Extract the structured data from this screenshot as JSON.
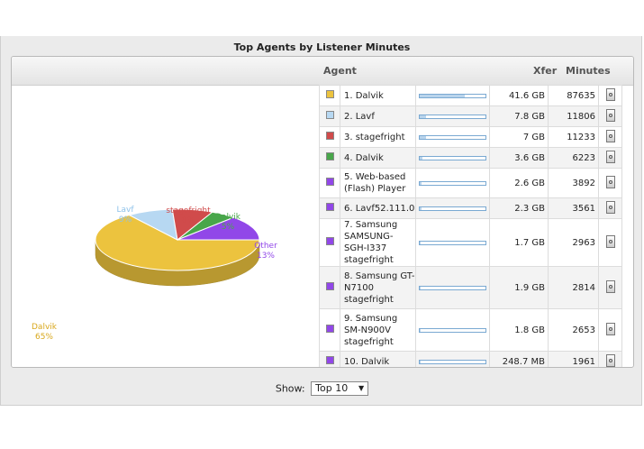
{
  "title": "Top Agents by Listener Minutes",
  "columns": {
    "agent": "Agent",
    "xfer": "Xfer",
    "minutes": "Minutes"
  },
  "rows": [
    {
      "name": "1. Dalvik",
      "xfer": "41.6 GB",
      "minutes": "87635",
      "color": "#ecc33e",
      "bar": 0.68
    },
    {
      "name": "2. Lavf",
      "xfer": "7.8 GB",
      "minutes": "11806",
      "color": "#b7d8f2",
      "bar": 0.1
    },
    {
      "name": "3. stagefright",
      "xfer": "7 GB",
      "minutes": "11233",
      "color": "#d04b4b",
      "bar": 0.09
    },
    {
      "name": "4. Dalvik",
      "xfer": "3.6 GB",
      "minutes": "6223",
      "color": "#48a64a",
      "bar": 0.04
    },
    {
      "name": "5. Web-based (Flash) Player",
      "xfer": "2.6 GB",
      "minutes": "3892",
      "color": "#9147e8",
      "bar": 0.03
    },
    {
      "name": "6. Lavf52.111.0",
      "xfer": "2.3 GB",
      "minutes": "3561",
      "color": "#9147e8",
      "bar": 0.03
    },
    {
      "name": "7. Samsung SAMSUNG-SGH-I337 stagefright",
      "xfer": "1.7 GB",
      "minutes": "2963",
      "color": "#9147e8",
      "bar": 0.02
    },
    {
      "name": "8. Samsung GT-N7100 stagefright",
      "xfer": "1.9 GB",
      "minutes": "2814",
      "color": "#9147e8",
      "bar": 0.02
    },
    {
      "name": "9. Samsung SM-N900V stagefright",
      "xfer": "1.8 GB",
      "minutes": "2653",
      "color": "#9147e8",
      "bar": 0.02
    },
    {
      "name": "10. Dalvik",
      "xfer": "248.7 MB",
      "minutes": "1961",
      "color": "#9147e8",
      "bar": 0.01
    }
  ],
  "chart_data": {
    "type": "pie",
    "title": "",
    "slices": [
      {
        "label": "Dalvik",
        "pct_label": "65%",
        "value": 65,
        "color": "#ecc33e"
      },
      {
        "label": "Lavf",
        "pct_label": "9%",
        "value": 9,
        "color": "#b7d8f2"
      },
      {
        "label": "stagefright",
        "pct_label": "8%",
        "value": 8,
        "color": "#d04b4b"
      },
      {
        "label": "Dalvik",
        "pct_label": "5%",
        "value": 5,
        "color": "#48a64a"
      },
      {
        "label": "Other",
        "pct_label": "13%",
        "value": 13,
        "color": "#9147e8"
      }
    ]
  },
  "show": {
    "label": "Show:",
    "selected": "Top 10"
  },
  "icons": {
    "row_action": "player-icon",
    "dropdown": "chevron-down-icon"
  }
}
